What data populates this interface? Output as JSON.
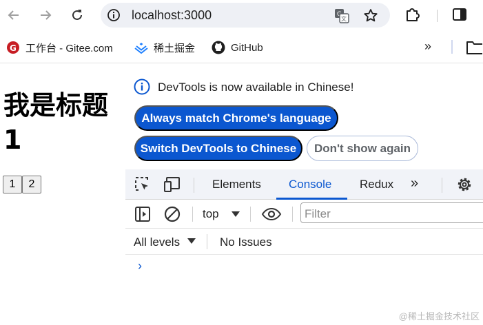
{
  "toolbar": {
    "url": "localhost:3000",
    "icons": [
      "back-arrow-icon",
      "forward-arrow-icon",
      "reload-icon",
      "site-info-icon",
      "translate-icon",
      "bookmark-star-icon",
      "extensions-icon",
      "side-panel-icon"
    ]
  },
  "bookmarks": {
    "items": [
      {
        "label": "工作台 - Gitee.com",
        "icon": "gitee-icon"
      },
      {
        "label": "稀土掘金",
        "icon": "juejin-icon"
      },
      {
        "label": "GitHub",
        "icon": "github-icon"
      }
    ],
    "more": "»"
  },
  "page": {
    "title": "我是标题1",
    "buttons": [
      "1",
      "2"
    ]
  },
  "devtools": {
    "infobar": {
      "message": "DevTools is now available in Chinese!",
      "always_match": "Always match Chrome's language",
      "switch_chinese": "Switch DevTools to Chinese",
      "dont_show": "Don't show again"
    },
    "tabs": [
      {
        "label": "Elements",
        "active": false
      },
      {
        "label": "Console",
        "active": true
      },
      {
        "label": "Redux",
        "active": false
      }
    ],
    "more_tabs": "»",
    "console": {
      "context": "top",
      "filter_placeholder": "Filter",
      "levels": "All levels",
      "issues": "No Issues",
      "prompt": "›"
    },
    "accent": "#0b57d0"
  },
  "watermark": "@稀土掘金技术社区"
}
